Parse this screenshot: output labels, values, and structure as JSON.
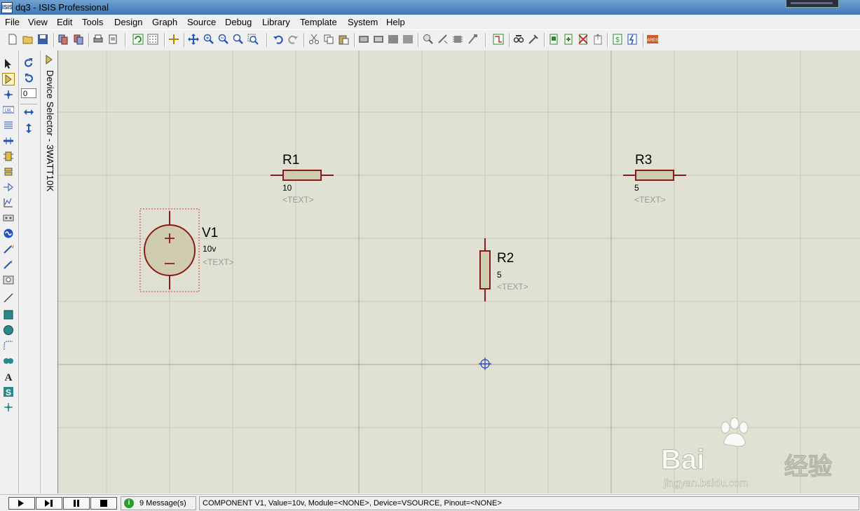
{
  "window": {
    "title": "dq3 - ISIS Professional",
    "app_icon": "ISIS"
  },
  "menu": [
    "File",
    "View",
    "Edit",
    "Tools",
    "Design",
    "Graph",
    "Source",
    "Debug",
    "Library",
    "Template",
    "System",
    "Help"
  ],
  "side_panel": {
    "label": "Device Selector - 3WATT10K",
    "rotation_value": "0"
  },
  "schematic": {
    "components": [
      {
        "ref": "V1",
        "value": "10v",
        "text": "<TEXT>"
      },
      {
        "ref": "R1",
        "value": "10",
        "text": "<TEXT>"
      },
      {
        "ref": "R2",
        "value": "5",
        "text": "<TEXT>"
      },
      {
        "ref": "R3",
        "value": "5",
        "text": "<TEXT>"
      }
    ]
  },
  "statusbar": {
    "messages": "9 Message(s)",
    "status": "COMPONENT V1, Value=10v, Module=<NONE>, Device=VSOURCE, Pinout=<NONE>"
  },
  "watermark": {
    "brand": "Bai",
    "brand2": "经验",
    "url": "jingyan.baidu.com"
  },
  "colors": {
    "canvas": "#e1e1d3",
    "component": "#8b1a1a",
    "body_fill": "#d0ccb0",
    "selection": "#e03030",
    "grid": "#c8c8b8"
  }
}
